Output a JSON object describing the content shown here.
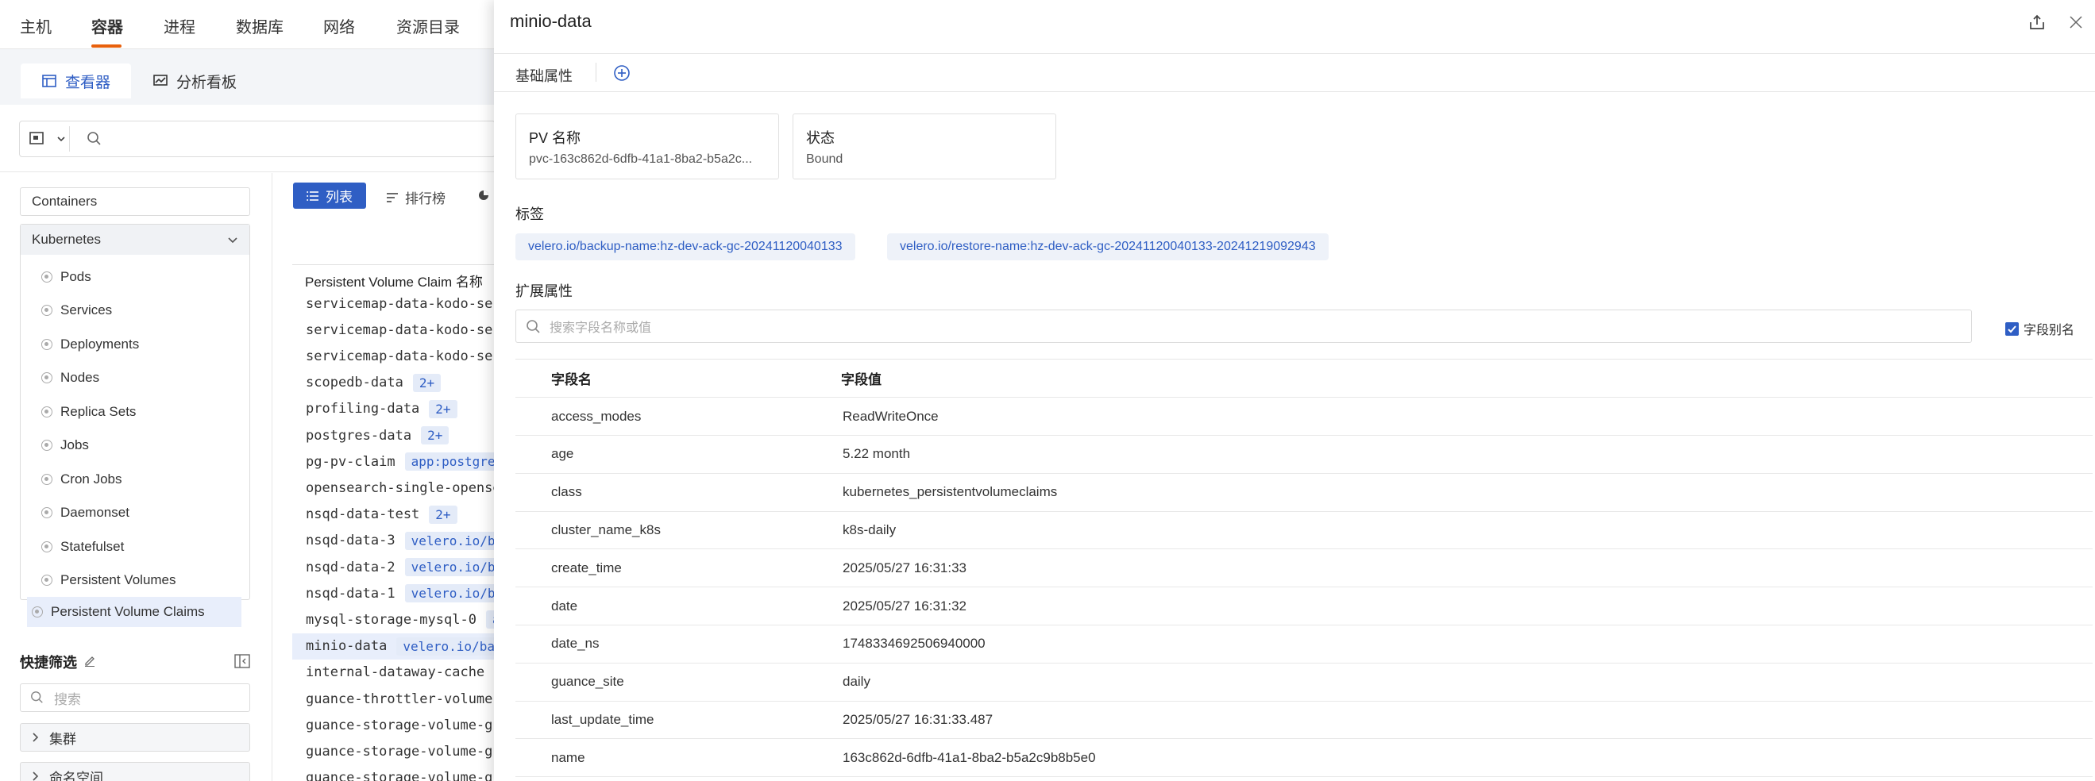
{
  "topnav": {
    "items": [
      "主机",
      "容器",
      "进程",
      "数据库",
      "网络",
      "资源目录"
    ]
  },
  "view_tabs": {
    "viewer": "查看器",
    "dashboard": "分析看板"
  },
  "sidebar": {
    "containers": "Containers",
    "kubernetes": "Kubernetes",
    "k8s_items": [
      "Pods",
      "Services",
      "Deployments",
      "Nodes",
      "Replica Sets",
      "Jobs",
      "Cron Jobs",
      "Daemonset",
      "Statefulset",
      "Persistent Volumes",
      "Persistent Volume Claims"
    ],
    "quick_filter_title": "快捷筛选",
    "quick_filter_placeholder": "搜索",
    "filter_groups": [
      "集群",
      "命名空间"
    ]
  },
  "list": {
    "list_btn": "列表",
    "rank_btn": "排行榜",
    "column_header": "Persistent Volume Claim 名称",
    "rows": [
      {
        "name": "servicemap-data-kodo-ser",
        "tag": ""
      },
      {
        "name": "servicemap-data-kodo-ser",
        "tag": ""
      },
      {
        "name": "servicemap-data-kodo-ser",
        "tag": ""
      },
      {
        "name": "scopedb-data",
        "tag": "2+"
      },
      {
        "name": "profiling-data",
        "tag": "2+"
      },
      {
        "name": "postgres-data",
        "tag": "2+"
      },
      {
        "name": "pg-pv-claim",
        "tag": "app:postgre"
      },
      {
        "name": "opensearch-single-opense",
        "tag": ""
      },
      {
        "name": "nsqd-data-test",
        "tag": "2+"
      },
      {
        "name": "nsqd-data-3",
        "tag": "velero.io/b"
      },
      {
        "name": "nsqd-data-2",
        "tag": "velero.io/b"
      },
      {
        "name": "nsqd-data-1",
        "tag": "velero.io/b"
      },
      {
        "name": "mysql-storage-mysql-0",
        "tag": "a"
      },
      {
        "name": "minio-data",
        "tag": "velero.io/ba"
      },
      {
        "name": "internal-dataway-cache",
        "tag": ""
      },
      {
        "name": "guance-throttler-volume-",
        "tag": ""
      },
      {
        "name": "guance-storage-volume-gu",
        "tag": ""
      },
      {
        "name": "guance-storage-volume-gu",
        "tag": ""
      },
      {
        "name": "guance-storage-volume-gu",
        "tag": ""
      }
    ]
  },
  "drawer": {
    "title": "minio-data",
    "basic_tab": "基础属性",
    "pv_name_label": "PV 名称",
    "pv_name_value": "pvc-163c862d-6dfb-41a1-8ba2-b5a2c...",
    "status_label": "状态",
    "status_value": "Bound",
    "labels_title": "标签",
    "labels": [
      "velero.io/backup-name:hz-dev-ack-gc-20241120040133",
      "velero.io/restore-name:hz-dev-ack-gc-20241120040133-20241219092943"
    ],
    "ext_title": "扩展属性",
    "field_search_placeholder": "搜索字段名称或值",
    "alias_label": "字段别名",
    "col_field": "字段名",
    "col_value": "字段值",
    "fields": [
      {
        "k": "access_modes",
        "v": "ReadWriteOnce"
      },
      {
        "k": "age",
        "v": "5.22 month"
      },
      {
        "k": "class",
        "v": "kubernetes_persistentvolumeclaims"
      },
      {
        "k": "cluster_name_k8s",
        "v": "k8s-daily"
      },
      {
        "k": "create_time",
        "v": "2025/05/27 16:31:33"
      },
      {
        "k": "date",
        "v": "2025/05/27 16:31:32"
      },
      {
        "k": "date_ns",
        "v": "1748334692506940000"
      },
      {
        "k": "guance_site",
        "v": "daily"
      },
      {
        "k": "last_update_time",
        "v": "2025/05/27 16:31:33.487"
      },
      {
        "k": "name",
        "v": "163c862d-6dfb-41a1-8ba2-b5a2c9b8b5e0"
      }
    ]
  }
}
